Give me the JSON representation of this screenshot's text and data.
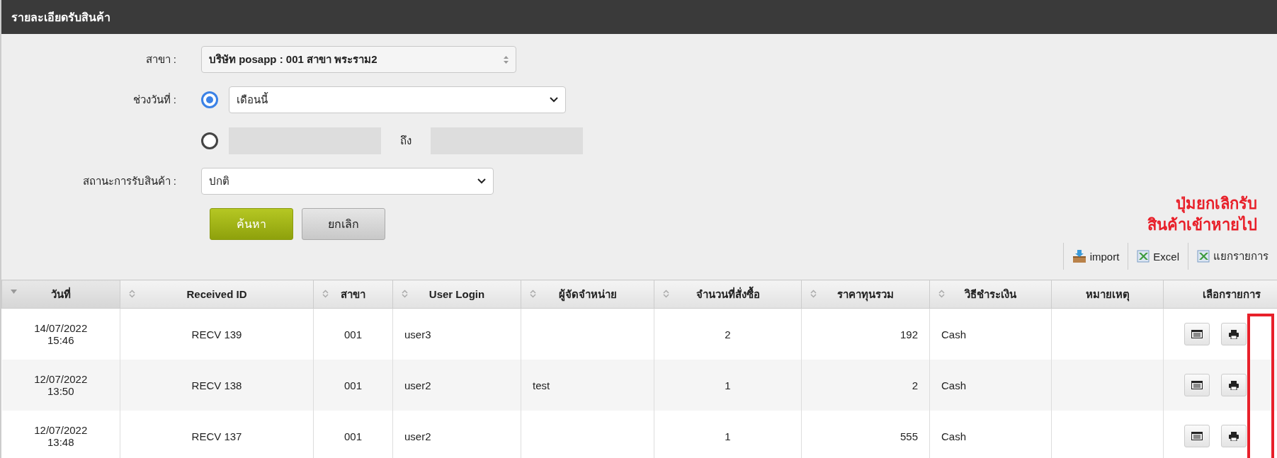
{
  "panel": {
    "title": "รายละเอียดรับสินค้า"
  },
  "form": {
    "branch": {
      "label": "สาขา :",
      "value": "บริษัท posapp : 001 สาขา พระราม2"
    },
    "date_range": {
      "label": "ช่วงวันที่ :",
      "options": [
        {
          "kind": "preset",
          "selected": true,
          "value": "เดือนนี้"
        },
        {
          "kind": "range",
          "selected": false,
          "to_label": "ถึง"
        }
      ]
    },
    "status": {
      "label": "สถานะการรับสินค้า :",
      "value": "ปกติ"
    },
    "buttons": [
      {
        "kind": "primary",
        "label": "ค้นหา"
      },
      {
        "kind": "secondary",
        "label": "ยกเลิก"
      }
    ]
  },
  "annotation": {
    "text_lines": [
      "ปุ่มยกเลิกรับ",
      "สินค้าเข้าหายไป"
    ]
  },
  "toolbar": [
    {
      "kind": "import",
      "label": "import"
    },
    {
      "kind": "excel",
      "label": "Excel"
    },
    {
      "kind": "excel",
      "label": "แยกรายการ"
    }
  ],
  "table": {
    "columns": [
      {
        "label": "วันที่",
        "sortable": true,
        "sorted": true
      },
      {
        "label": "Received ID",
        "sortable": true,
        "sorted": false
      },
      {
        "label": "สาขา",
        "sortable": true,
        "sorted": false
      },
      {
        "label": "User Login",
        "sortable": true,
        "sorted": false
      },
      {
        "label": "ผู้จัดจำหน่าย",
        "sortable": true,
        "sorted": false
      },
      {
        "label": "จำนวนที่สั่งซื้อ",
        "sortable": true,
        "sorted": false
      },
      {
        "label": "ราคาทุนรวม",
        "sortable": true,
        "sorted": false
      },
      {
        "label": "วิธีชำระเงิน",
        "sortable": true,
        "sorted": false
      },
      {
        "label": "หมายเหตุ",
        "sortable": false
      },
      {
        "label": "เลือกรายการ",
        "sortable": false
      }
    ],
    "rows": [
      {
        "date": "14/07/2022",
        "time": "15:46",
        "received_id": "RECV 139",
        "branch": "001",
        "user": "user3",
        "quantity": "2",
        "total_cost": "192",
        "payment": "Cash"
      },
      {
        "date": "12/07/2022",
        "time": "13:50",
        "received_id": "RECV 138",
        "branch": "001",
        "user": "user2",
        "supplier": "test",
        "quantity": "1",
        "total_cost": "2",
        "payment": "Cash"
      },
      {
        "date": "12/07/2022",
        "time": "13:48",
        "received_id": "RECV 137",
        "branch": "001",
        "user": "user2",
        "quantity": "1",
        "total_cost": "555",
        "payment": "Cash"
      }
    ]
  }
}
